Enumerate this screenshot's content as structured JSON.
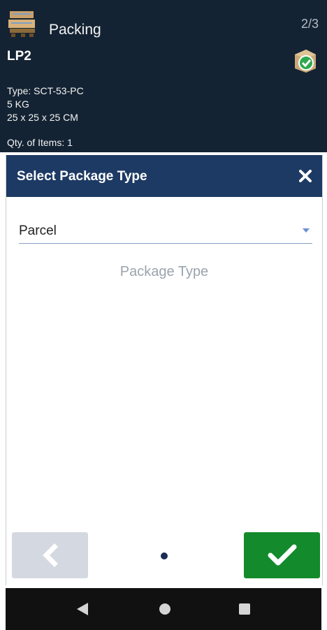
{
  "header": {
    "title": "Packing",
    "page_count": "2/3",
    "lp_title": "LP2",
    "type_line": "Type: SCT-53-PC",
    "weight_line": "5 KG",
    "dims_line": "25 x 25 x 25 CM",
    "qty_line": "Qty. of Items: 1",
    "app_icon": "pallet-boxes-icon",
    "status_icon": "box-check-icon"
  },
  "dialog": {
    "title": "Select Package Type",
    "close_icon": "close-icon",
    "select_value": "Parcel",
    "field_label": "Package Type"
  },
  "footer": {
    "back_icon": "chevron-left-icon",
    "confirm_icon": "checkmark-icon"
  },
  "colors": {
    "header_bg": "#142333",
    "dialog_header_bg": "#1d3a64",
    "confirm_green": "#138a2b",
    "back_button_bg": "#d4d9e1"
  }
}
